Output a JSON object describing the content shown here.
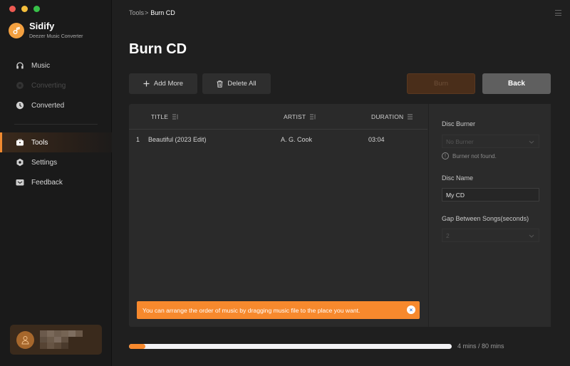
{
  "window": {
    "controls": [
      "close",
      "minimize",
      "maximize"
    ]
  },
  "brand": {
    "name": "Sidify",
    "subtitle": "Deezer Music Converter",
    "logo_icon": "music-note-icon",
    "accent_color": "#f7892d"
  },
  "sidebar": {
    "items": [
      {
        "id": "music",
        "label": "Music",
        "icon": "headphones-icon",
        "state": "normal"
      },
      {
        "id": "converting",
        "label": "Converting",
        "icon": "converting-icon",
        "state": "disabled"
      },
      {
        "id": "converted",
        "label": "Converted",
        "icon": "clock-icon",
        "state": "normal"
      },
      {
        "id": "tools",
        "label": "Tools",
        "icon": "toolbox-icon",
        "state": "active"
      },
      {
        "id": "settings",
        "label": "Settings",
        "icon": "gear-icon",
        "state": "normal"
      },
      {
        "id": "feedback",
        "label": "Feedback",
        "icon": "mail-icon",
        "state": "normal"
      }
    ],
    "user": {
      "avatar_icon": "user-icon",
      "name_blurred": true
    }
  },
  "header": {
    "breadcrumb": {
      "root": "Tools",
      "separator": ">",
      "current": "Burn CD"
    },
    "menu_icon": "hamburger-icon",
    "page_title": "Burn CD"
  },
  "toolbar": {
    "add_more_label": "Add More",
    "delete_all_label": "Delete All",
    "burn_label": "Burn",
    "back_label": "Back"
  },
  "table": {
    "columns": [
      {
        "key": "title",
        "label": "TITLE"
      },
      {
        "key": "artist",
        "label": "ARTIST"
      },
      {
        "key": "duration",
        "label": "DURATION"
      }
    ],
    "rows": [
      {
        "index": "1",
        "title": "Beautiful (2023 Edit)",
        "artist": "A. G. Cook",
        "duration": "03:04"
      }
    ]
  },
  "tip": {
    "text": "You can arrange the order of music by dragging music file to the place you want.",
    "close_label": "×"
  },
  "settings": {
    "disc_burner": {
      "label": "Disc Burner",
      "value": "No Burner",
      "note": "Burner not found.",
      "note_icon": "!"
    },
    "disc_name": {
      "label": "Disc Name",
      "value": "My CD"
    },
    "gap": {
      "label": "Gap Between Songs(seconds)",
      "value": "2"
    }
  },
  "capacity": {
    "used_mins": 4,
    "total_mins": 80,
    "fraction": 0.05,
    "text": "4 mins / 80 mins"
  }
}
